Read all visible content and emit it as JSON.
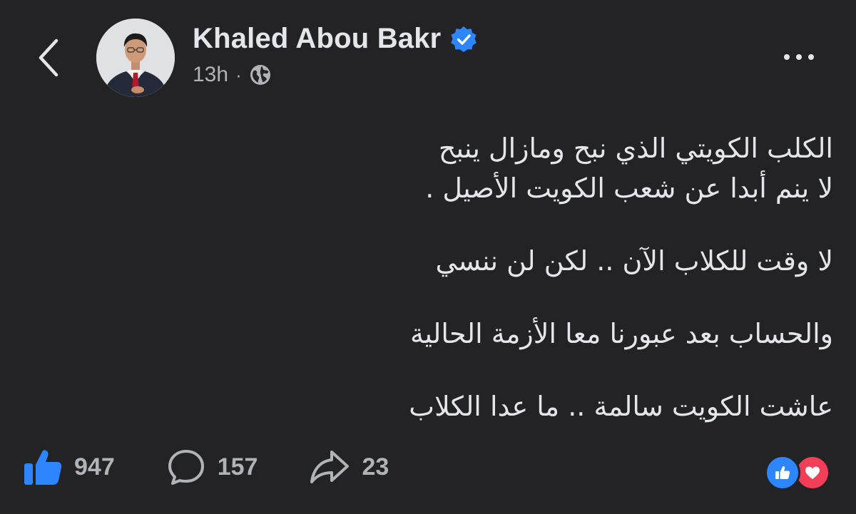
{
  "header": {
    "author_name": "Khaled Abou Bakr",
    "timestamp": "13h",
    "separator": "·",
    "audience_icon": "globe-icon",
    "back_icon": "chevron-left-icon",
    "more_icon": "more-horizontal-icon",
    "verified_icon": "verified-badge-icon"
  },
  "post": {
    "lines": [
      "الكلب الكويتي الذي نبح ومازال ينبح",
      "لا ينم أبدا عن شعب الكويت الأصيل .",
      "لا وقت للكلاب الآن .. لكن لن ننسي",
      "والحساب بعد عبورنا معا الأزمة الحالية",
      "عاشت الكويت سالمة .. ما عدا الكلاب"
    ]
  },
  "actions": {
    "like_count": "947",
    "comment_count": "157",
    "share_count": "23",
    "like_icon": "thumbs-up-icon",
    "comment_icon": "comment-bubble-icon",
    "share_icon": "share-arrow-icon"
  },
  "reactions": {
    "icons": [
      "like-reaction-icon",
      "love-reaction-icon"
    ]
  },
  "colors": {
    "background": "#232325",
    "primary_text": "#e4e6eb",
    "secondary_text": "#b0b3b8",
    "accent_blue": "#2d86ff",
    "love_red": "#f33e58"
  }
}
